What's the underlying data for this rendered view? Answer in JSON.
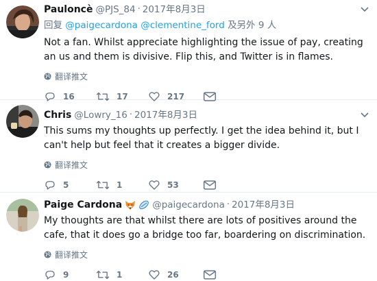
{
  "tweets": [
    {
      "name": "Pauloncè",
      "handle": "@PJS_84",
      "separator": "·",
      "time": "2017年8月3日",
      "reply_prefix": "回复",
      "reply_mentions": "@paigecardona @clementine_ford",
      "reply_suffix": "及另外 9 人",
      "text": "Not a fan. Whilst appreciate highlighting the issue of pay, creating an us and them is divisive. Flip this, and Twitter is in flames.",
      "translate_label": "翻译推文",
      "replies": "16",
      "retweets": "17",
      "likes": "217"
    },
    {
      "name": "Chris",
      "handle": "@Lowry_16",
      "separator": "·",
      "time": "2017年8月3日",
      "text": "This sums my thoughts up perfectly. I get the idea behind it, but I can't help but feel that it creates a bigger divide.",
      "translate_label": "翻译推文",
      "replies": "5",
      "retweets": "1",
      "likes": "53"
    },
    {
      "name": "Paige Cardona",
      "handle": "@paigecardona",
      "separator": "·",
      "time": "2017年8月3日",
      "name_emojis": [
        "fox-face-icon",
        "rugby-ball-icon"
      ],
      "text": "My thoughts are that whilst there are lots of positives around the cafe, that it does go a bridge too far, boardering on discrimination.",
      "translate_label": "翻译推文",
      "replies": "9",
      "retweets": "1",
      "likes": "26"
    }
  ],
  "colors": {
    "link": "#1da1f2",
    "secondary_text": "#657786",
    "divider": "#e6ecf0"
  }
}
